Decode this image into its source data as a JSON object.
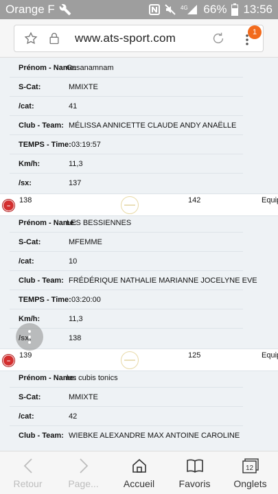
{
  "statusbar": {
    "carrier": "Orange F",
    "network": "4G",
    "battery": "66%",
    "time": "13:56"
  },
  "browser": {
    "url": "www.ats-sport.com",
    "badge_count": "1"
  },
  "labels": {
    "name": "Prénom - Name:",
    "scat": "S-Cat:",
    "cat": "/cat:",
    "club": "Club - Team:",
    "time": "TEMPS - Time:",
    "kmh": "Km/h:",
    "sx": "/sx:"
  },
  "entries": [
    {
      "name": "Casanamnam",
      "scat": "MMIXTE",
      "cat": "41",
      "club": "MÉLISSA ANNICETTE CLAUDE ANDY ANAËLLE",
      "time": "03:19:57",
      "kmh": "11,3",
      "sx": "137"
    },
    {
      "row": {
        "rank": "138",
        "bib": "142",
        "type": "Equip"
      },
      "name": "LES BESSIENNES",
      "scat": "MFEMME",
      "cat": "10",
      "club": "FRÉDÉRIQUE NATHALIE MARIANNE JOCELYNE EVE",
      "time": "03:20:00",
      "kmh": "11,3",
      "sx": "138"
    },
    {
      "row": {
        "rank": "139",
        "bib": "125",
        "type": "Equip"
      },
      "name": "les cubis tonics",
      "scat": "MMIXTE",
      "cat": "42",
      "club": "WIEBKE ALEXANDRE MAX ANTOINE CAROLINE"
    }
  ],
  "nav": {
    "back": "Retour",
    "forward": "Page...",
    "home": "Accueil",
    "bookmarks": "Favoris",
    "tabs": "Onglets",
    "tabs_count": "12"
  }
}
